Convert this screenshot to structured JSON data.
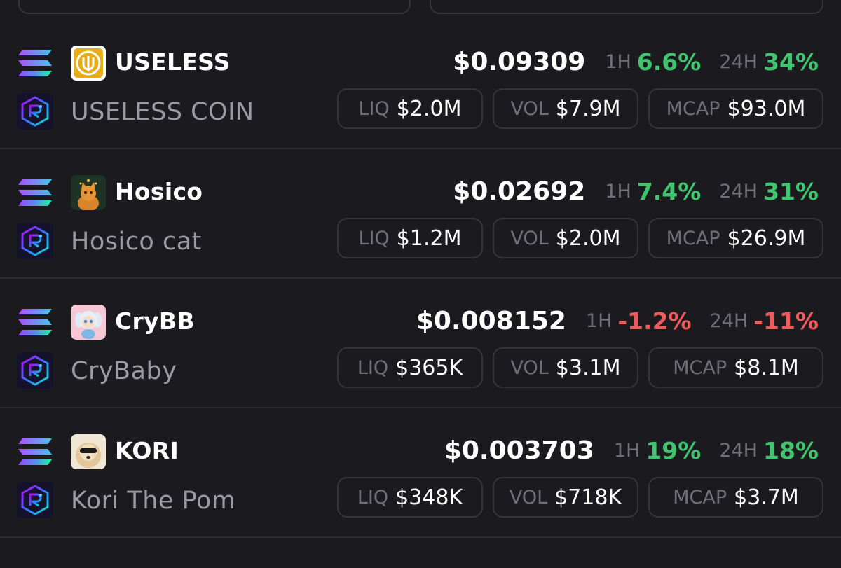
{
  "colors": {
    "background": "#1b1b1f",
    "positive": "#3fc56e",
    "negative": "#f05a5a",
    "muted": "#6f6f78",
    "name": "#9a9aa3"
  },
  "labels": {
    "h1": "1H",
    "h24": "24H",
    "liq": "LIQ",
    "vol": "VOL",
    "mcap": "MCAP"
  },
  "tokens": [
    {
      "symbol": "USELESS",
      "name": "USELESS COIN",
      "price": "$0.09309",
      "change_1h": "6.6%",
      "change_1h_dir": "up",
      "change_24h": "34%",
      "change_24h_dir": "up",
      "liq": "$2.0M",
      "vol": "$7.9M",
      "mcap": "$93.0M",
      "chain_icon": "solana-icon",
      "dex_icon": "raydium-icon",
      "avatar": "useless-logo"
    },
    {
      "symbol": "Hosico",
      "name": "Hosico cat",
      "price": "$0.02692",
      "change_1h": "7.4%",
      "change_1h_dir": "up",
      "change_24h": "31%",
      "change_24h_dir": "up",
      "liq": "$1.2M",
      "vol": "$2.0M",
      "mcap": "$26.9M",
      "chain_icon": "solana-icon",
      "dex_icon": "raydium-icon",
      "avatar": "hosico-cat-avatar"
    },
    {
      "symbol": "CryBB",
      "name": "CryBaby",
      "price": "$0.008152",
      "change_1h": "-1.2%",
      "change_1h_dir": "down",
      "change_24h": "-11%",
      "change_24h_dir": "down",
      "liq": "$365K",
      "vol": "$3.1M",
      "mcap": "$8.1M",
      "chain_icon": "solana-icon",
      "dex_icon": "raydium-icon",
      "avatar": "crybaby-avatar"
    },
    {
      "symbol": "KORI",
      "name": "Kori The Pom",
      "price": "$0.003703",
      "change_1h": "19%",
      "change_1h_dir": "up",
      "change_24h": "18%",
      "change_24h_dir": "up",
      "liq": "$348K",
      "vol": "$718K",
      "mcap": "$3.7M",
      "chain_icon": "solana-icon",
      "dex_icon": "raydium-icon",
      "avatar": "kori-pom-avatar"
    }
  ]
}
